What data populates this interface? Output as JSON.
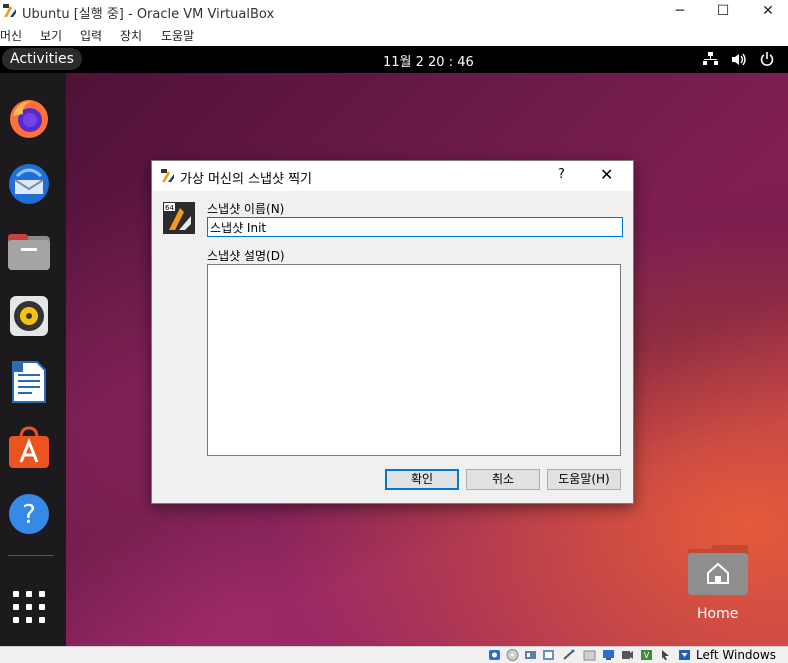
{
  "window": {
    "title": "Ubuntu [실행 중] - Oracle VM VirtualBox",
    "controls": {
      "minimize": "─",
      "maximize": "☐",
      "close": "✕"
    }
  },
  "menubar": {
    "items": [
      "머신",
      "보기",
      "입력",
      "장치",
      "도움말"
    ]
  },
  "guest": {
    "activities": "Activities",
    "clock": "11월 2 20 : 46",
    "dock": {
      "icons": [
        "firefox-icon",
        "thunderbird-icon",
        "files-icon",
        "rhythmbox-icon",
        "libreoffice-writer-icon",
        "ubuntu-software-icon",
        "help-icon",
        "app-grid-icon"
      ]
    },
    "desktop": {
      "home_label": "Home"
    }
  },
  "dialog": {
    "title": "가상 머신의 스냅샷 찍기",
    "help": "?",
    "close": "✕",
    "name_label": "스냅샷 이름(N)",
    "name_value": "스냅샷 Init",
    "description_label": "스냅샷 설명(D)",
    "description_value": "",
    "buttons": {
      "ok": "확인",
      "cancel": "취소",
      "help": "도움말(H)"
    }
  },
  "statusbar": {
    "host_key": "Left Windows"
  },
  "colors": {
    "focus_blue": "#0078d7",
    "dock_bg": "#1c1a1d",
    "topbar_bg": "#000000"
  }
}
